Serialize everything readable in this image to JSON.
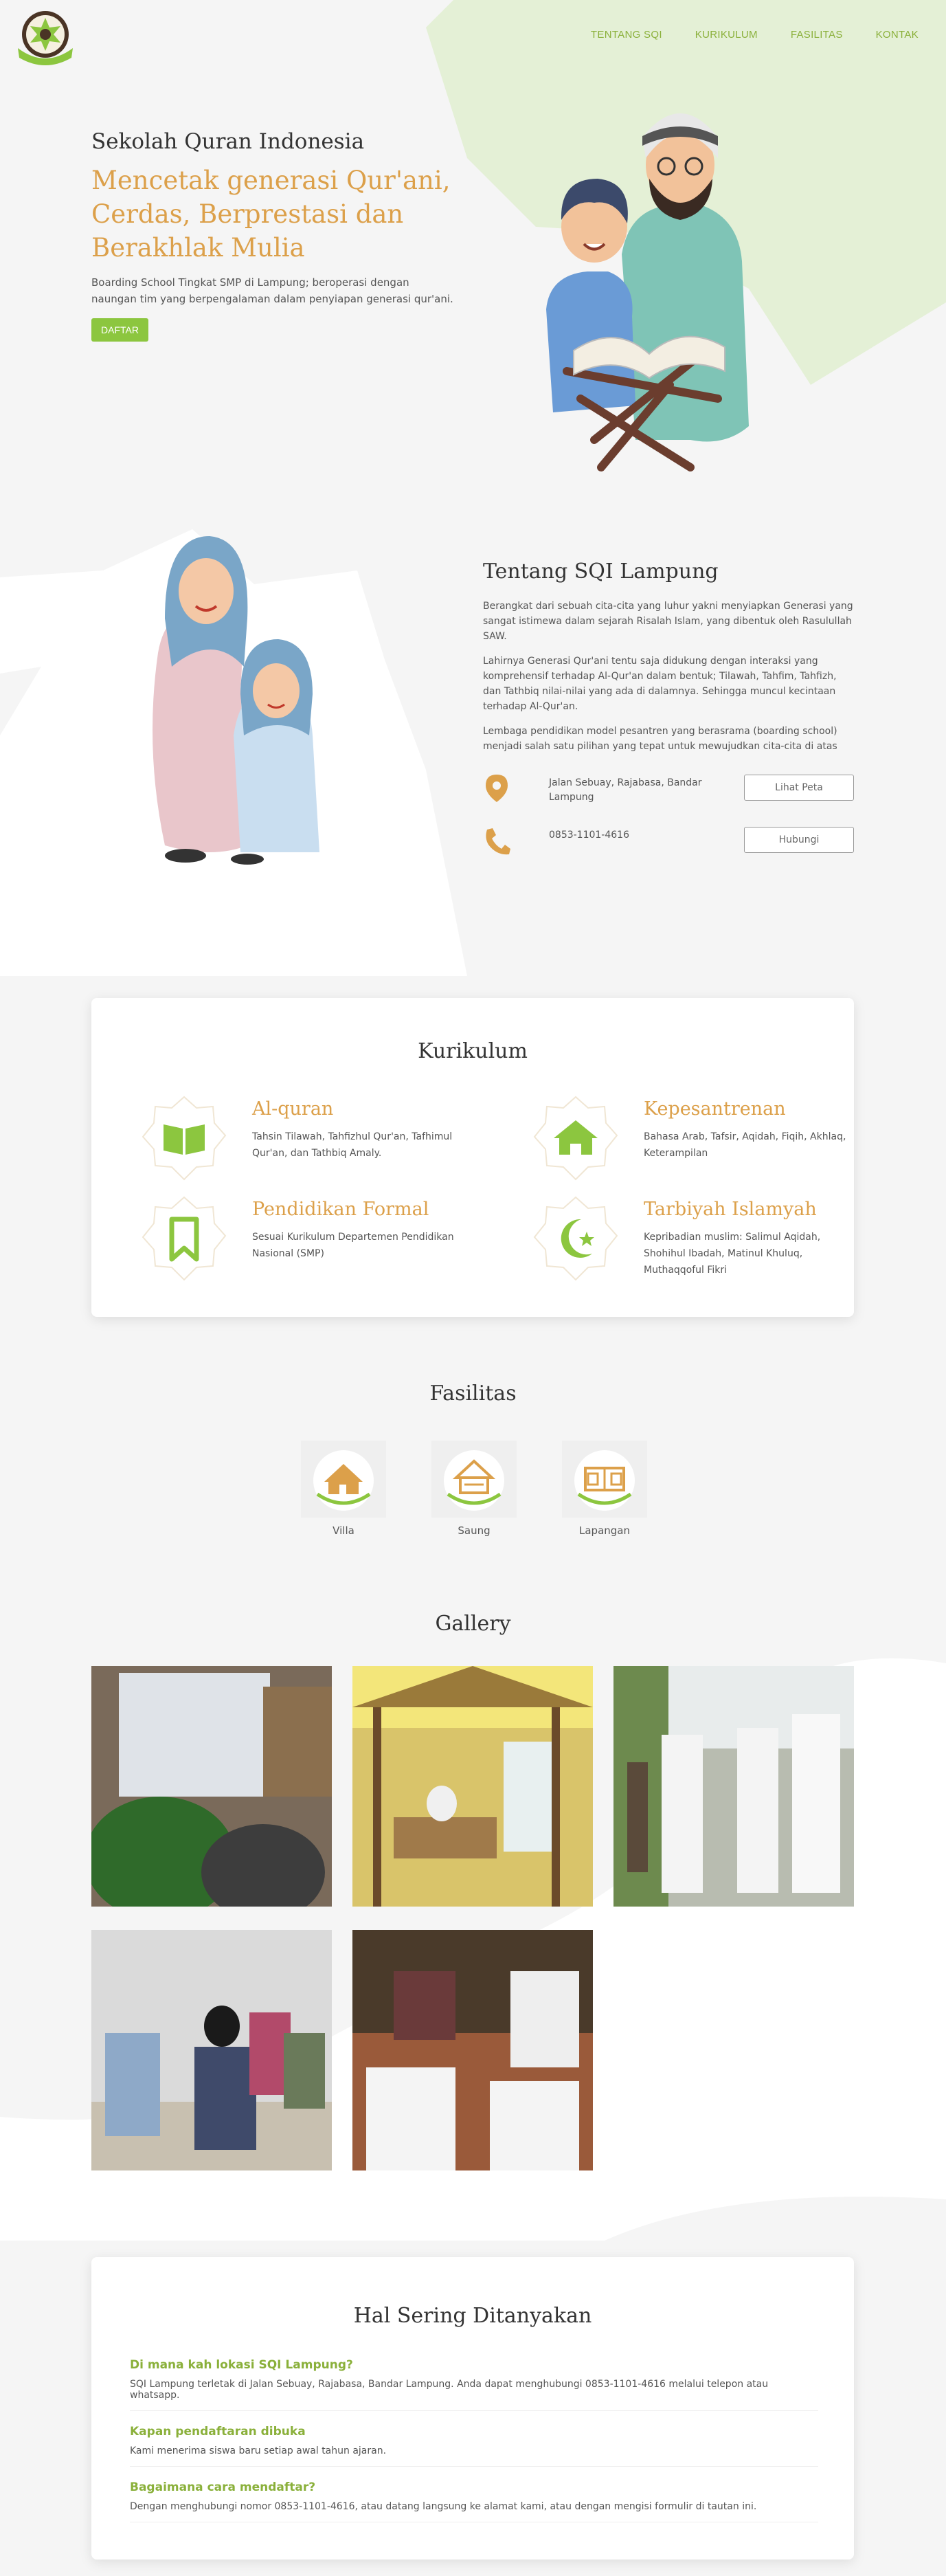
{
  "nav": {
    "links": [
      "TENTANG SQI",
      "KURIKULUM",
      "FASILITAS",
      "KONTAK"
    ]
  },
  "hero": {
    "kicker": "Sekolah Quran Indonesia",
    "title": "Mencetak generasi Qur'ani, Cerdas, Berprestasi dan Berakhlak Mulia",
    "description": "Boarding School Tingkat SMP di Lampung; beroperasi dengan naungan tim yang berpengalaman dalam penyiapan generasi qur'ani.",
    "cta": "DAFTAR"
  },
  "about": {
    "title": "Tentang SQI Lampung",
    "paragraphs": [
      "Berangkat dari sebuah cita-cita yang luhur yakni menyiapkan Generasi yang sangat istimewa dalam sejarah Risalah Islam, yang dibentuk oleh Rasulullah SAW.",
      "Lahirnya Generasi Qur'ani tentu saja didukung dengan interaksi yang komprehensif terhadap Al-Qur'an dalam bentuk; Tilawah, Tahfim, Tahfizh, dan Tathbiq nilai-nilai yang ada di dalamnya. Sehingga muncul kecintaan terhadap Al-Qur'an.",
      "Lembaga pendidikan model pesantren yang berasrama (boarding school) menjadi salah satu pilihan yang tepat untuk mewujudkan cita-cita di atas"
    ],
    "address": "Jalan Sebuay, Rajabasa, Bandar Lampung",
    "address_button": "Lihat Peta",
    "phone": "0853-1101-4616",
    "phone_button": "Hubungi",
    "address_icon": "location-pin-icon",
    "phone_icon": "phone-icon"
  },
  "kurikulum": {
    "title": "Kurikulum",
    "items": [
      {
        "name": "Al-quran",
        "desc": "Tahsin Tilawah, Tahfizhul Qur'an, Tafhimul Qur'an, dan Tathbiq Amaly.",
        "icon": "book-icon"
      },
      {
        "name": "Kepesantrenan",
        "desc": "Bahasa Arab, Tafsir, Aqidah, Fiqih, Akhlaq, Keterampilan",
        "icon": "home-icon"
      },
      {
        "name": "Pendidikan Formal",
        "desc": "Sesuai Kurikulum Departemen Pendidikan Nasional (SMP)",
        "icon": "bookmark-icon"
      },
      {
        "name": "Tarbiyah Islamyah",
        "desc": "Kepribadian muslim: Salimul Aqidah, Shohihul Ibadah, Matinul Khuluq, Muthaqqoful Fikri",
        "icon": "crescent-star-icon"
      }
    ]
  },
  "fasilitas": {
    "title": "Fasilitas",
    "items": [
      {
        "label": "Villa",
        "icon": "villa-icon"
      },
      {
        "label": "Saung",
        "icon": "saung-icon"
      },
      {
        "label": "Lapangan",
        "icon": "field-icon"
      }
    ]
  },
  "gallery": {
    "title": "Gallery"
  },
  "faq": {
    "title": "Hal Sering Ditanyakan",
    "items": [
      {
        "q": "Di mana kah lokasi SQI Lampung?",
        "a": "SQI Lampung terletak di Jalan Sebuay, Rajabasa, Bandar Lampung. Anda dapat menghubungi 0853-1101-4616 melalui telepon atau whatsapp."
      },
      {
        "q": "Kapan pendaftaran dibuka",
        "a": "Kami menerima siswa baru setiap awal tahun ajaran."
      },
      {
        "q": "Bagaimana cara mendaftar?",
        "a": "Dengan menghubungi nomor 0853-1101-4616, atau datang langsung ke alamat kami, atau dengan mengisi formulir di tautan ini."
      }
    ]
  },
  "colors": {
    "accent_green": "#8cc63f",
    "accent_gold": "#dca04a",
    "nav_green": "#8ab03a",
    "hero_shape": "#e4f0d6"
  }
}
